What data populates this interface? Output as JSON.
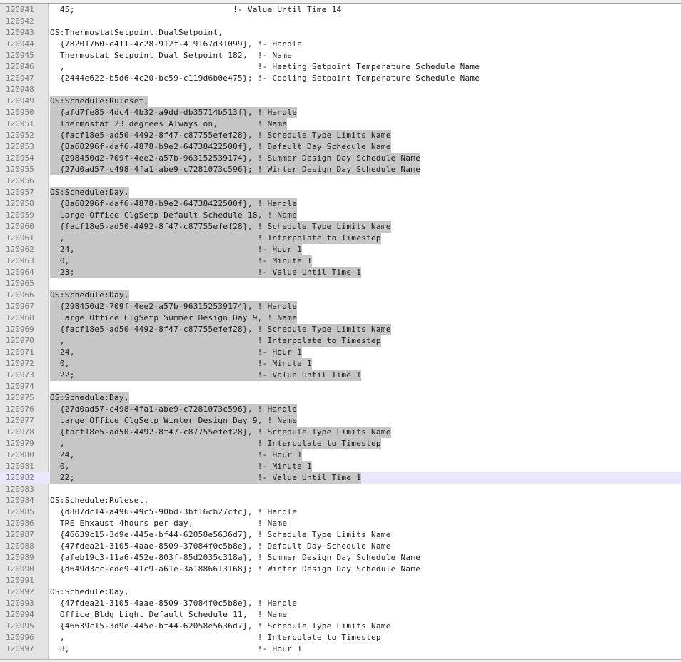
{
  "editor": {
    "lines": [
      {
        "num": "120941",
        "text": "  45;                                !- Value Until Time 14",
        "selected": false
      },
      {
        "num": "120942",
        "text": "",
        "selected": false
      },
      {
        "num": "120943",
        "text": "OS:ThermostatSetpoint:DualSetpoint,",
        "selected": false
      },
      {
        "num": "120944",
        "text": "  {78201760-e411-4c28-912f-419167d31099}, !- Handle",
        "selected": false
      },
      {
        "num": "120945",
        "text": "  Thermostat Setpoint Dual Setpoint 182,  !- Name",
        "selected": false
      },
      {
        "num": "120946",
        "text": "  ,                                       !- Heating Setpoint Temperature Schedule Name",
        "selected": false
      },
      {
        "num": "120947",
        "text": "  {2444e622-b5d6-4c20-bc59-c119d6b0e475}; !- Cooling Setpoint Temperature Schedule Name",
        "selected": false
      },
      {
        "num": "120948",
        "text": "",
        "selected": false
      },
      {
        "num": "120949",
        "text": "OS:Schedule:Ruleset,",
        "selected": true
      },
      {
        "num": "120950",
        "text": "  {afd7fe85-4dc4-4b32-a9dd-db35714b513f}, ! Handle",
        "selected": true
      },
      {
        "num": "120951",
        "text": "  Thermostat 23 degrees Always on,        ! Name",
        "selected": true
      },
      {
        "num": "120952",
        "text": "  {facf18e5-ad50-4492-8f47-c87755efef28}, ! Schedule Type Limits Name",
        "selected": true
      },
      {
        "num": "120953",
        "text": "  {8a60296f-daf6-4878-b9e2-64738422500f}, ! Default Day Schedule Name",
        "selected": true
      },
      {
        "num": "120954",
        "text": "  {298450d2-709f-4ee2-a57b-963152539174}, ! Summer Design Day Schedule Name",
        "selected": true
      },
      {
        "num": "120955",
        "text": "  {27d0ad57-c498-4fa1-abe9-c7281073c596}; ! Winter Design Day Schedule Name",
        "selected": true
      },
      {
        "num": "120956",
        "text": "",
        "selected": true
      },
      {
        "num": "120957",
        "text": "OS:Schedule:Day,",
        "selected": true
      },
      {
        "num": "120958",
        "text": "  {8a60296f-daf6-4878-b9e2-64738422500f}, ! Handle",
        "selected": true
      },
      {
        "num": "120959",
        "text": "  Large Office ClgSetp Default Schedule 18, ! Name",
        "selected": true
      },
      {
        "num": "120960",
        "text": "  {facf18e5-ad50-4492-8f47-c87755efef28}, ! Schedule Type Limits Name",
        "selected": true
      },
      {
        "num": "120961",
        "text": "  ,                                       ! Interpolate to Timestep",
        "selected": true
      },
      {
        "num": "120962",
        "text": "  24,                                     !- Hour 1",
        "selected": true
      },
      {
        "num": "120963",
        "text": "  0,                                      !- Minute 1",
        "selected": true
      },
      {
        "num": "120964",
        "text": "  23;                                     !- Value Until Time 1",
        "selected": true
      },
      {
        "num": "120965",
        "text": "",
        "selected": true
      },
      {
        "num": "120966",
        "text": "OS:Schedule:Day,",
        "selected": true
      },
      {
        "num": "120967",
        "text": "  {298450d2-709f-4ee2-a57b-963152539174}, ! Handle",
        "selected": true
      },
      {
        "num": "120968",
        "text": "  Large Office ClgSetp Summer Design Day 9, ! Name",
        "selected": true
      },
      {
        "num": "120969",
        "text": "  {facf18e5-ad50-4492-8f47-c87755efef28}, ! Schedule Type Limits Name",
        "selected": true
      },
      {
        "num": "120970",
        "text": "  ,                                       ! Interpolate to Timestep",
        "selected": true
      },
      {
        "num": "120971",
        "text": "  24,                                     !- Hour 1",
        "selected": true
      },
      {
        "num": "120972",
        "text": "  0,                                      !- Minute 1",
        "selected": true
      },
      {
        "num": "120973",
        "text": "  22;                                     !- Value Until Time 1",
        "selected": true
      },
      {
        "num": "120974",
        "text": "",
        "selected": true
      },
      {
        "num": "120975",
        "text": "OS:Schedule:Day,",
        "selected": true
      },
      {
        "num": "120976",
        "text": "  {27d0ad57-c498-4fa1-abe9-c7281073c596}, ! Handle",
        "selected": true
      },
      {
        "num": "120977",
        "text": "  Large Office ClgSetp Winter Design Day 9, ! Name",
        "selected": true
      },
      {
        "num": "120978",
        "text": "  {facf18e5-ad50-4492-8f47-c87755efef28}, ! Schedule Type Limits Name",
        "selected": true
      },
      {
        "num": "120979",
        "text": "  ,                                       ! Interpolate to Timestep",
        "selected": true
      },
      {
        "num": "120980",
        "text": "  24,                                     !- Hour 1",
        "selected": true
      },
      {
        "num": "120981",
        "text": "  0,                                      !- Minute 1",
        "selected": true
      },
      {
        "num": "120982",
        "text": "  22;                                     !- Value Until Time 1",
        "selected": true,
        "current": true
      },
      {
        "num": "120983",
        "text": "",
        "selected": false
      },
      {
        "num": "120984",
        "text": "OS:Schedule:Ruleset,",
        "selected": false
      },
      {
        "num": "120985",
        "text": "  {d807dc14-a496-49c5-90bd-3bf16cb27cfc}, ! Handle",
        "selected": false
      },
      {
        "num": "120986",
        "text": "  TRE Ehxaust 4hours per day,             ! Name",
        "selected": false
      },
      {
        "num": "120987",
        "text": "  {46639c15-3d9e-445e-bf44-62058e5636d7}, ! Schedule Type Limits Name",
        "selected": false
      },
      {
        "num": "120988",
        "text": "  {47fdea21-3105-4aae-8509-37084f0c5b8e}, ! Default Day Schedule Name",
        "selected": false
      },
      {
        "num": "120989",
        "text": "  {afeb19c3-11a6-452e-803f-85d2035c318a}, ! Summer Design Day Schedule Name",
        "selected": false
      },
      {
        "num": "120990",
        "text": "  {d649d3cc-ede9-41c9-a61e-3a1886613168}; ! Winter Design Day Schedule Name",
        "selected": false
      },
      {
        "num": "120991",
        "text": "",
        "selected": false
      },
      {
        "num": "120992",
        "text": "OS:Schedule:Day,",
        "selected": false
      },
      {
        "num": "120993",
        "text": "  {47fdea21-3105-4aae-8509-37084f0c5b8e}, ! Handle",
        "selected": false
      },
      {
        "num": "120994",
        "text": "  Office Bldg Light Default Schedule 11,  ! Name",
        "selected": false
      },
      {
        "num": "120995",
        "text": "  {46639c15-3d9e-445e-bf44-62058e5636d7}, ! Schedule Type Limits Name",
        "selected": false
      },
      {
        "num": "120996",
        "text": "  ,                                       ! Interpolate to Timestep",
        "selected": false
      },
      {
        "num": "120997",
        "text": "  8,                                      !- Hour 1",
        "selected": false
      }
    ]
  },
  "colors": {
    "selection": "#c6c6c6",
    "current_line": "#e8e8ff",
    "gutter": "#e4e4e4",
    "line_number": "#7a7a7a",
    "text": "#1a1a1a"
  }
}
